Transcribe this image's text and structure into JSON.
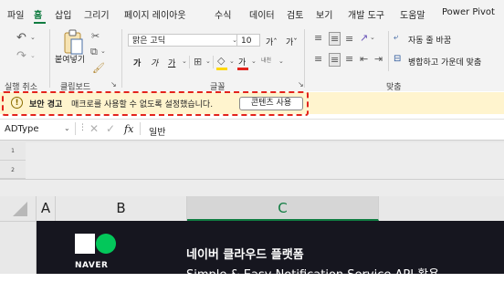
{
  "tabs": [
    "파일",
    "홈",
    "삽입",
    "그리기",
    "페이지 레이아웃",
    "수식",
    "데이터",
    "검토",
    "보기",
    "개발 도구",
    "도움말",
    "Power Pivot"
  ],
  "ribbon": {
    "paste_label": "붙여넣기",
    "font_name": "맑은 고딕",
    "font_size": "10",
    "font_grow": "가ˆ",
    "font_shrink": "가ˇ",
    "bold": "가",
    "italic": "가",
    "underline": "가",
    "font_color_letter": "가",
    "phonetic": "내천",
    "wrap_text": "자동 줄 바꿈",
    "merge_center": "병합하고 가운데 맞춤",
    "groups": {
      "undo": "실행 취소",
      "clipboard": "클립보드",
      "font": "글꼴",
      "alignment": "맞춤"
    }
  },
  "message_bar": {
    "title": "보안 경고",
    "text": "매크로를 사용할 수 없도록 설정했습니다.",
    "button": "콘텐츠 사용"
  },
  "formula_bar": {
    "name_box": "ADType",
    "fx": "fx",
    "value": "일반"
  },
  "rows": [
    "1",
    "2"
  ],
  "columns": [
    "A",
    "B",
    "C"
  ],
  "content": {
    "naver_text": "NAVER",
    "title": "네이버 클라우드 플랫폼",
    "subtitle": "Simple & Easy Notification Service API 활용"
  },
  "colors": {
    "excel_green": "#107c41",
    "message_bar": "#fff4ce",
    "highlight_border": "#e3231c",
    "naver_green": "#03c75a",
    "dark_bg": "#16161f"
  }
}
